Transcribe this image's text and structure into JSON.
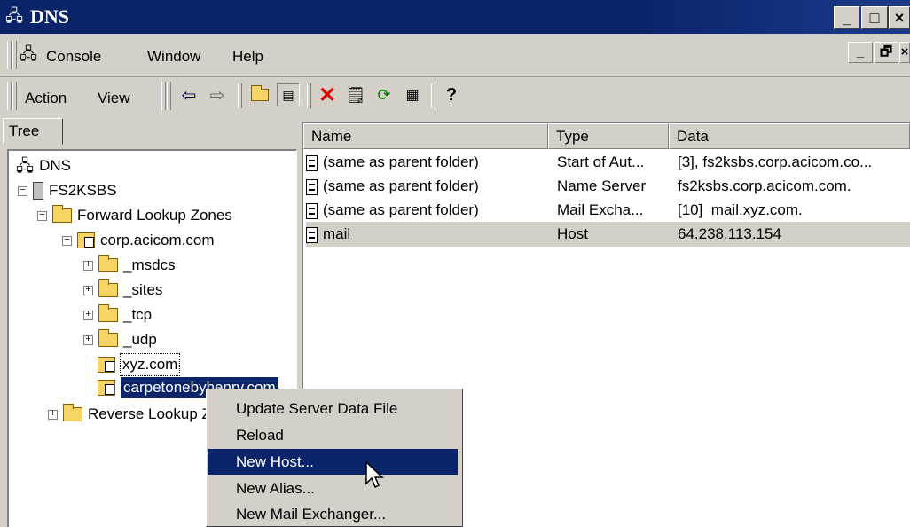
{
  "window": {
    "title": "DNS",
    "minimize": "_",
    "maximize": "□",
    "close": "×"
  },
  "menu": {
    "items": [
      {
        "label": "Console",
        "underline": "C"
      },
      {
        "label": "Window",
        "underline": "W"
      },
      {
        "label": "Help",
        "underline": "H"
      }
    ],
    "mdi_min": "_",
    "mdi_restore": "🗗",
    "mdi_close": "×"
  },
  "toolbar": {
    "action_label": "Action",
    "view_label": "View",
    "icons": [
      "back-arrow-icon",
      "forward-arrow-icon",
      "up-folder-icon",
      "show-tree-icon",
      "delete-icon",
      "properties-icon",
      "refresh-icon",
      "export-list-icon",
      "help-icon"
    ]
  },
  "tree": {
    "tab_label": "Tree",
    "nodes": [
      {
        "label": "DNS"
      },
      {
        "label": "FS2KSBS"
      },
      {
        "label": "Forward Lookup Zones"
      },
      {
        "label": "corp.acicom.com"
      },
      {
        "label": "_msdcs"
      },
      {
        "label": "_sites"
      },
      {
        "label": "_tcp"
      },
      {
        "label": "_udp"
      },
      {
        "label": "xyz.com"
      },
      {
        "label": "carpetonebyhenry.com"
      },
      {
        "label": "Reverse Lookup Zones"
      }
    ]
  },
  "list": {
    "columns": [
      "Name",
      "Type",
      "Data"
    ],
    "rows": [
      {
        "name": "(same as parent folder)",
        "type": "Start of Aut...",
        "data": "[3], fs2ksbs.corp.acicom.co..."
      },
      {
        "name": "(same as parent folder)",
        "type": "Name Server",
        "data": "fs2ksbs.corp.acicom.com."
      },
      {
        "name": "(same as parent folder)",
        "type": "Mail Excha...",
        "data": "[10]  mail.xyz.com."
      },
      {
        "name": "mail",
        "type": "Host",
        "data": "64.238.113.154"
      }
    ]
  },
  "context_menu": {
    "items": [
      "Update Server Data File",
      "Reload",
      "New Host...",
      "New Alias...",
      "New Mail Exchanger..."
    ],
    "highlighted": "New Host..."
  },
  "colors": {
    "titlebar": "#0a246a",
    "face": "#d4d0c8",
    "selection": "#0a246a",
    "delete_icon": "#e00000"
  }
}
